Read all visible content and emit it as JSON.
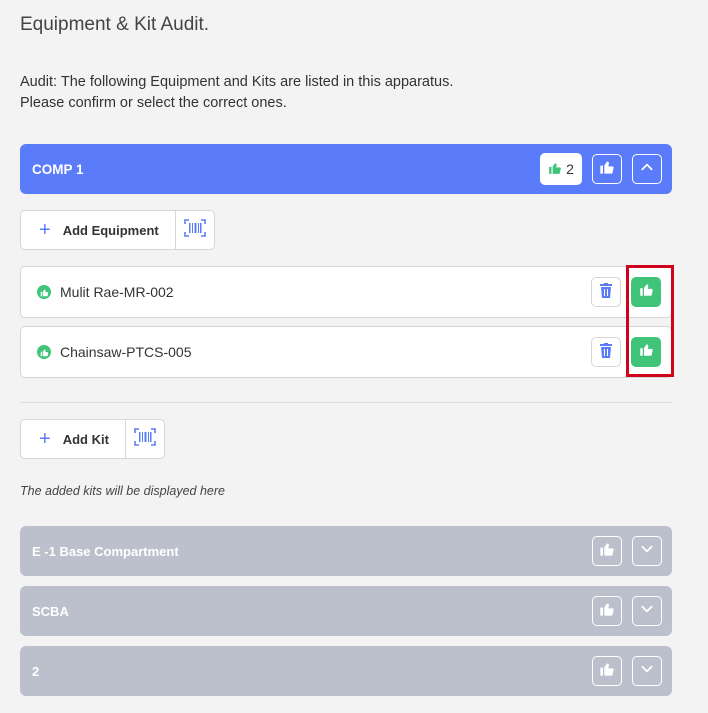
{
  "page": {
    "title": "Equipment & Kit Audit.",
    "intro_line1": "Audit: The following Equipment and Kits are listed in this apparatus.",
    "intro_line2": "Please confirm or select the correct ones."
  },
  "compartment": {
    "name": "COMP 1",
    "confirmed_count": "2",
    "color": "#5b7cfa"
  },
  "add_equipment": {
    "label": "Add Equipment"
  },
  "equipment": [
    {
      "name": "Mulit Rae-MR-002",
      "status": "confirmed"
    },
    {
      "name": "Chainsaw-PTCS-005",
      "status": "confirmed"
    }
  ],
  "add_kit": {
    "label": "Add Kit"
  },
  "kits_note": "The added kits will be displayed here",
  "kits": [
    {
      "name": "E -1 Base Compartment"
    },
    {
      "name": "SCBA"
    },
    {
      "name": "2"
    }
  ],
  "colors": {
    "accent": "#5b7cfa",
    "confirm_green": "#3fc47a",
    "kit_header_gray": "#bcc0cc",
    "highlight_red": "#d0021b"
  },
  "icons": {
    "thumbs_up": "thumbs-up-icon",
    "chevron_up": "chevron-up-icon",
    "chevron_down": "chevron-down-icon",
    "trash": "trash-icon",
    "barcode": "barcode-scan-icon",
    "plus": "plus-icon"
  }
}
